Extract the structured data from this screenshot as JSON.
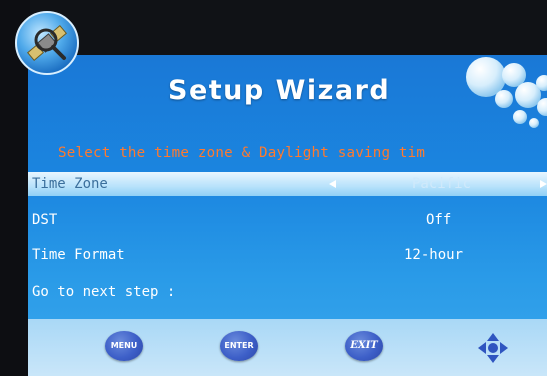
{
  "header": {
    "title": "Setup Wizard",
    "subtitle": "Select the time zone & Daylight saving tim"
  },
  "settings": [
    {
      "label": "Time Zone",
      "value": "Pacific",
      "selected": true
    },
    {
      "label": "DST",
      "value": "Off",
      "selected": false
    },
    {
      "label": "Time Format",
      "value": "12-hour",
      "selected": false
    },
    {
      "label": "Go to next step :",
      "value": "",
      "selected": false
    }
  ],
  "footer": {
    "menu_label": "MENU",
    "enter_label": "ENTER",
    "exit_label": "EXIT",
    "nav_icon": "dpad-arrows-icon"
  },
  "colors": {
    "screen_blue": "#1b86e0",
    "subtitle_orange": "#ff7a2e",
    "footer_button": "#3d5fc8",
    "dpad": "#2f55c0"
  },
  "icons": {
    "logo": "satellite-magnifier-logo-icon",
    "decoration": "bubbles-icon"
  }
}
